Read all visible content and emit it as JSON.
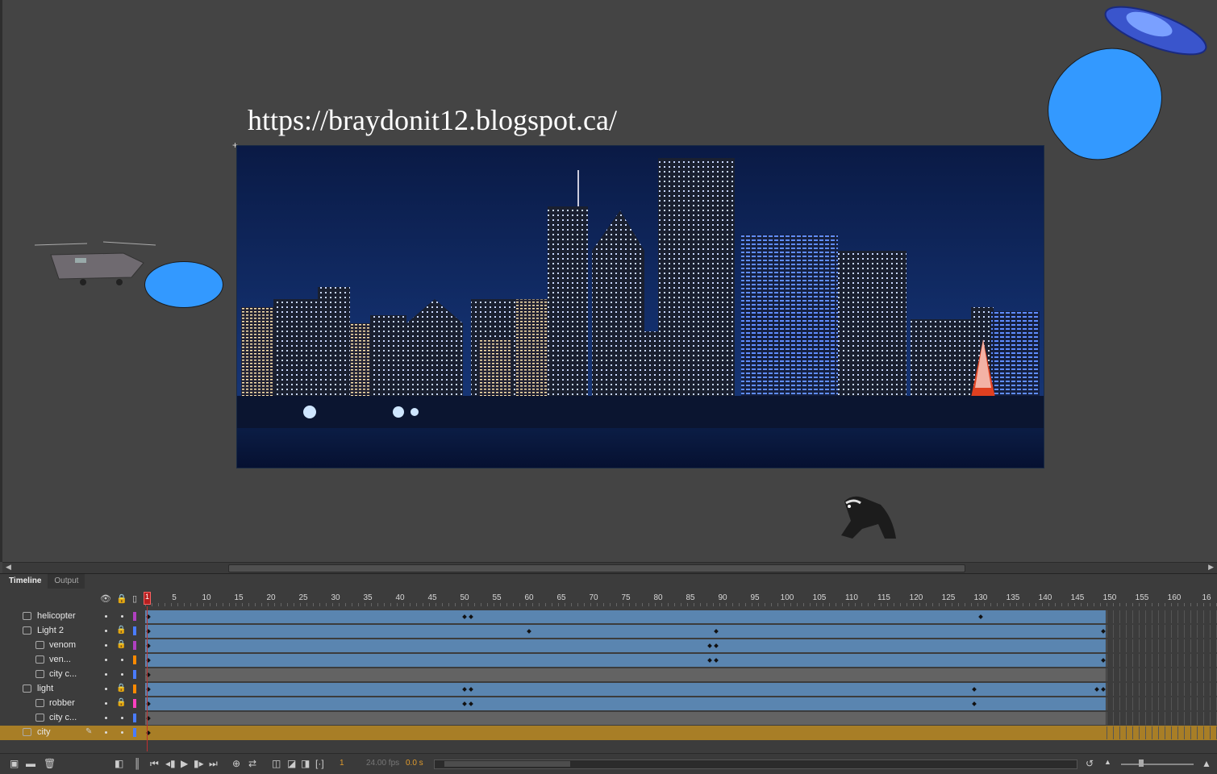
{
  "stage": {
    "url_text": "https://braydonit12.blogspot.ca/",
    "blob_color": "#3399ff"
  },
  "panel": {
    "tabs": [
      "Timeline",
      "Output"
    ],
    "ruler_ticks": [
      "1",
      "5",
      "10",
      "15",
      "20",
      "25",
      "30",
      "35",
      "40",
      "45",
      "50",
      "55",
      "60",
      "65",
      "70",
      "75",
      "80",
      "85",
      "90",
      "95",
      "100",
      "105",
      "110",
      "115",
      "120",
      "125",
      "130",
      "135",
      "140",
      "145",
      "150",
      "155",
      "160",
      "16"
    ],
    "current_frame_marker": "1",
    "layers": [
      {
        "name": "helicopter",
        "icon": "guide-layer-icon",
        "indent": 0,
        "locked": false,
        "color": "#b040c0",
        "frames": "tween",
        "keyframes": [
          1,
          50,
          51,
          130
        ]
      },
      {
        "name": "Light 2",
        "icon": "mask-layer-icon",
        "indent": 0,
        "locked": true,
        "color": "#4a7cff",
        "frames": "tween",
        "keyframes": [
          1,
          60,
          89,
          149
        ]
      },
      {
        "name": "venom",
        "icon": "masked-layer-icon",
        "indent": 1,
        "locked": true,
        "color": "#b040c0",
        "frames": "tween",
        "keyframes": [
          1,
          88,
          89
        ]
      },
      {
        "name": "ven...",
        "icon": "masked-layer-icon",
        "indent": 1,
        "locked": false,
        "color": "#ff8a00",
        "frames": "tween",
        "keyframes": [
          1,
          88,
          89,
          149
        ]
      },
      {
        "name": "city c...",
        "icon": "masked-layer-icon",
        "indent": 1,
        "locked": false,
        "color": "#4a7cff",
        "frames": "gray",
        "keyframes": [
          1
        ]
      },
      {
        "name": "light",
        "icon": "mask-layer-icon",
        "indent": 0,
        "locked": true,
        "color": "#ff8a00",
        "frames": "tween",
        "keyframes": [
          1,
          50,
          51,
          129,
          148,
          149
        ]
      },
      {
        "name": "robber",
        "icon": "masked-layer-icon",
        "indent": 1,
        "locked": true,
        "color": "#ff40c0",
        "frames": "tween",
        "keyframes": [
          1,
          50,
          51,
          129
        ]
      },
      {
        "name": "city c...",
        "icon": "masked-layer-icon",
        "indent": 1,
        "locked": false,
        "color": "#4a7cff",
        "frames": "gray",
        "keyframes": [
          1
        ]
      },
      {
        "name": "city",
        "icon": "normal-layer-icon",
        "indent": 0,
        "locked": false,
        "color": "#4a7cff",
        "frames": "gold",
        "keyframes": [
          1
        ],
        "selected": true
      }
    ],
    "toolbar": {
      "frame": "1",
      "fps": "24.00 fps",
      "time": "0.0 s"
    }
  }
}
